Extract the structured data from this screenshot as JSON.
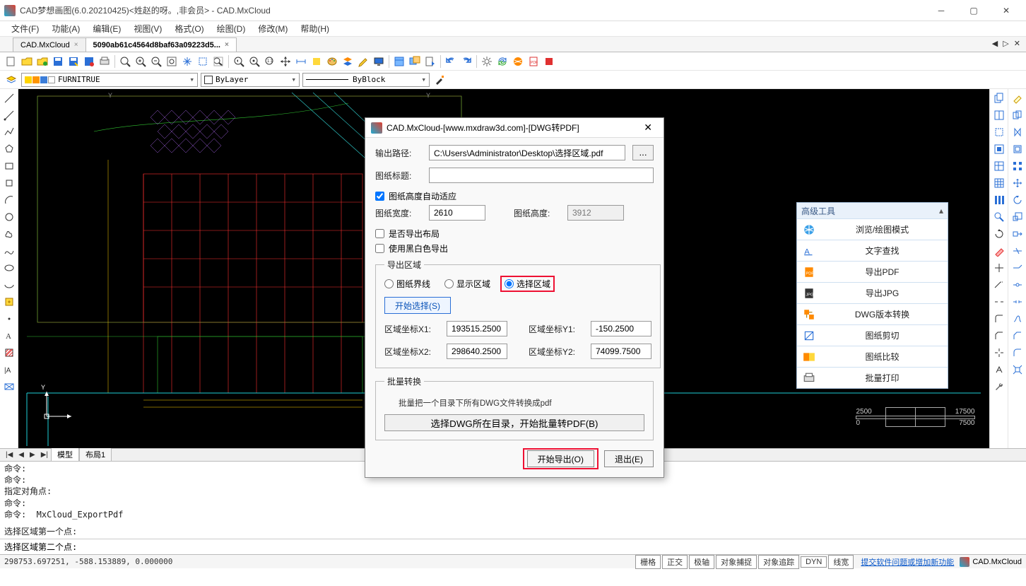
{
  "window": {
    "title": "CAD梦想画图(6.0.20210425)<姓赵的呀。,非会员> - CAD.MxCloud"
  },
  "menu": {
    "file": "文件(F)",
    "function": "功能(A)",
    "edit": "编辑(E)",
    "view": "视图(V)",
    "format": "格式(O)",
    "draw": "绘图(D)",
    "modify": "修改(M)",
    "help": "帮助(H)"
  },
  "docTabs": {
    "tab1": "CAD.MxCloud",
    "tab2": "5090ab61c4564d8baf63a09223d5..."
  },
  "layerBar": {
    "layer": "FURNITRUE",
    "color": "ByLayer",
    "linetype": "ByBlock"
  },
  "canvas": {
    "scaleLeft": "2500",
    "scaleRight": "17500",
    "scaleBL": "0",
    "scaleBR": "7500"
  },
  "layoutTabs": {
    "model": "模型",
    "layout1": "布局1"
  },
  "cmdLog": {
    "l1": "命令:",
    "l2": "命令:",
    "l3": "指定对角点:",
    "l4": "命令:",
    "l5": "命令:  MxCloud_ExportPdf",
    "l6": "选择区域第一个点:",
    "l7": "选择区域第二个点:"
  },
  "status": {
    "coords": "298753.697251,  -588.153889,  0.000000",
    "grid": "栅格",
    "ortho": "正交",
    "polar": "极轴",
    "osnap": "对象捕捉",
    "otrack": "对象追踪",
    "dyn": "DYN",
    "lw": "线宽",
    "feedback": "提交软件问题或增加新功能",
    "brand": "CAD.MxCloud"
  },
  "toolPanel": {
    "title": "高级工具",
    "browse": "浏览/绘图模式",
    "textfind": "文字查找",
    "pdf": "导出PDF",
    "jpg": "导出JPG",
    "dwgver": "DWG版本转换",
    "clip": "图纸剪切",
    "compare": "图纸比较",
    "batch": "批量打印"
  },
  "dialog": {
    "title": "CAD.MxCloud-[www.mxdraw3d.com]-[DWG转PDF]",
    "outPathLbl": "输出路径:",
    "outPath": "C:\\Users\\Administrator\\Desktop\\选择区域.pdf",
    "browse": "...",
    "titleLbl": "图纸标题:",
    "titleVal": "",
    "autoHeight": "图纸高度自动适应",
    "widthLbl": "图纸宽度:",
    "widthVal": "2610",
    "heightLbl": "图纸高度:",
    "heightVal": "3912",
    "exportLayout": "是否导出布局",
    "bw": "使用黑白色导出",
    "areaLegend": "导出区域",
    "rBounds": "图纸界线",
    "rDisplay": "显示区域",
    "rSelect": "选择区域",
    "startSelect": "开始选择(S)",
    "x1Lbl": "区域坐标X1:",
    "x1": "193515.2500",
    "y1Lbl": "区域坐标Y1:",
    "y1": "-150.2500",
    "x2Lbl": "区域坐标X2:",
    "x2": "298640.2500",
    "y2Lbl": "区域坐标Y2:",
    "y2": "74099.7500",
    "batchLegend": "批量转换",
    "batchHint": "批量把一个目录下所有DWG文件转换成pdf",
    "batchBtn": "选择DWG所在目录，开始批量转PDF(B)",
    "ok": "开始导出(O)",
    "exit": "退出(E)"
  }
}
